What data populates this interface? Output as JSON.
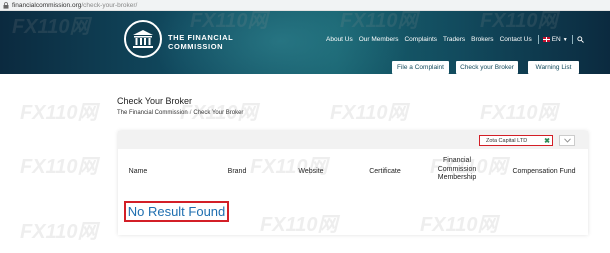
{
  "browser": {
    "url_host": "financialcommission.org",
    "url_path": "/check-your-broker/"
  },
  "header": {
    "logo_line1": "THE FINANCIAL",
    "logo_line2": "COMMISSION",
    "nav": [
      "About Us",
      "Our Members",
      "Complaints",
      "Traders",
      "Brokers",
      "Contact Us"
    ],
    "lang": "EN",
    "buttons": {
      "complaint": "File a Complaint",
      "check": "Check your Broker",
      "warning": "Warning List"
    }
  },
  "page": {
    "title": "Check Your Broker",
    "breadcrumb": [
      "The Financial Commission",
      "Check Your Broker"
    ],
    "breadcrumb_sep": "/"
  },
  "filter": {
    "value": "Zota Capital LTD"
  },
  "table": {
    "columns": [
      "Name",
      "Brand",
      "Website",
      "Certificate",
      "Financial Commission Membership",
      "Compensation Fund"
    ],
    "empty_message": "No Result Found"
  },
  "watermark": "FX110网",
  "colors": {
    "header_dark": "#0b2a3f",
    "header_teal": "#17606e",
    "highlight_red": "#d31f27",
    "no_result_blue": "#1f6fb0"
  }
}
